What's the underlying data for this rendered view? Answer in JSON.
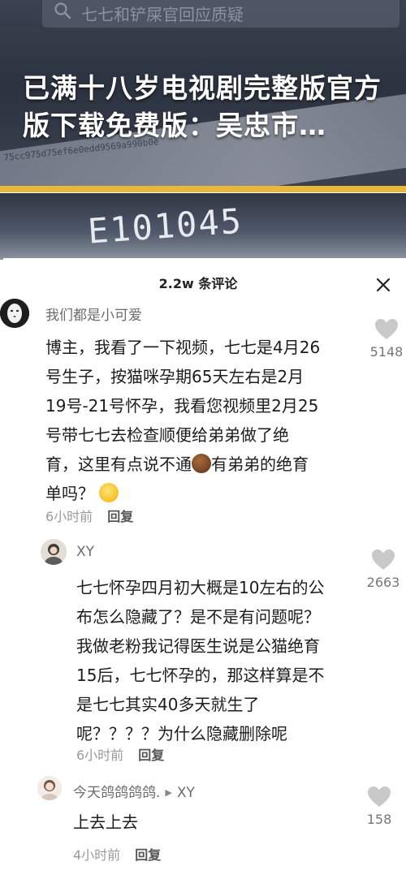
{
  "banner": {
    "search_placeholder": "七七和铲屎官回应质疑",
    "title": "已满十八岁电视剧完整版官方版下载免费版：吴忠市…",
    "hash_text": "75cc975d75ef6e0edd9569a990b0e",
    "counter_text": "E101045",
    "accent_color": "#e9b83a"
  },
  "comments_header": {
    "title": "2.2w 条评论",
    "close_icon": "close-icon"
  },
  "comments": [
    {
      "username": "我们都是小可爱",
      "text_lines": [
        "博主，我看了一下视频，七七是4月26",
        "号生子，按猫咪孕期65天左右是2月",
        "19号-21号怀孕，我看您视频里2月25",
        "号带七七去检查顺便给弟弟做了绝",
        "育，这里有点说不通",
        "有弟弟的绝育",
        "单吗？"
      ],
      "time": "6小时前",
      "reply_label": "回复",
      "likes": "5148"
    },
    {
      "username": "XY",
      "text_lines": [
        "七七怀孕四月初大概是10左右的公",
        "布怎么隐藏了？是不是有问题呢？",
        "我做老粉我记得医生说是公猫绝育",
        "15后，七七怀孕的，那这样算是不",
        "是七七其实40多天就生了",
        "呢？？？？为什么隐藏删除呢"
      ],
      "time": "6小时前",
      "reply_label": "回复",
      "likes": "2663"
    },
    {
      "username": "今天鸽鸽鸽鸽.",
      "reply_to": "XY",
      "text": "上去上去",
      "time": "4小时前",
      "reply_label": "回复",
      "likes": "158"
    }
  ]
}
